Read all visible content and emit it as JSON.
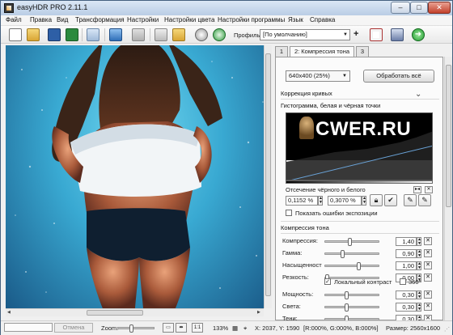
{
  "window": {
    "title": "easyHDR PRO 2.11.1",
    "min": "–",
    "max": "□",
    "close": "✕"
  },
  "menu": [
    "Файл",
    "Правка",
    "Вид",
    "Трансформация",
    "Настройки",
    "Настройки цвета",
    "Настройки программы",
    "Язык",
    "Справка"
  ],
  "toolbar": {
    "profile_label": "Профиль:",
    "profile_value": "[По умолчанию]",
    "profile_add": "+",
    "icons": [
      "new-file-icon",
      "open-folder-icon",
      "save-icon",
      "save-as-icon",
      "copy-icon",
      "previous-icon",
      "next-icon",
      "batch-open-icon",
      "batch-export-icon",
      "settings-icon",
      "options-icon",
      "report-icon",
      "box-icon",
      "go-icon"
    ]
  },
  "panel": {
    "tabs": [
      "1",
      "2: Компрессия тона",
      "3"
    ],
    "resize_value": "640x400 (25%)",
    "process_button": "Обработать всё",
    "curves_header": "Коррекция кривых",
    "histogram_header": "Гистограмма, белая и чёрная точки",
    "watermark": "CWER.RU",
    "clip_label": "Отсечение чёрного и белого",
    "clip_black": "0,1152 %",
    "clip_white": "0,3070 %",
    "show_errors_label": "Показать ошибки экспозиции",
    "tone_header": "Компрессия тона",
    "sliders": [
      {
        "label": "Компрессия:",
        "value": "1,40",
        "level": 0.45
      },
      {
        "label": "Гамма:",
        "value": "0,90",
        "level": 0.3
      },
      {
        "label": "Насыщенност",
        "value": "1,00",
        "level": 0.62
      },
      {
        "label": "Резкость:",
        "value": "0,00",
        "level": 0.0
      }
    ],
    "local_contrast_label": "Локальный контраст",
    "local_contrast_checked": true,
    "deg360_label": "360°",
    "deg360_checked": false,
    "local_sliders": [
      {
        "label": "Мощность:",
        "value": "0,30",
        "level": 0.38
      },
      {
        "label": "Света:",
        "value": "0,30",
        "level": 0.38
      },
      {
        "label": "Тени:",
        "value": "0,30",
        "level": 0.38
      }
    ]
  },
  "status": {
    "cancel": "Отмена",
    "zoom_label": "Zoom:",
    "zoom_level": 0.35,
    "zoom_percent": "133%",
    "coords": "X: 2037, Y: 1590",
    "rgb": "[R:000%, G:000%, B:000%]",
    "size": "Размер: 2560x1600"
  }
}
